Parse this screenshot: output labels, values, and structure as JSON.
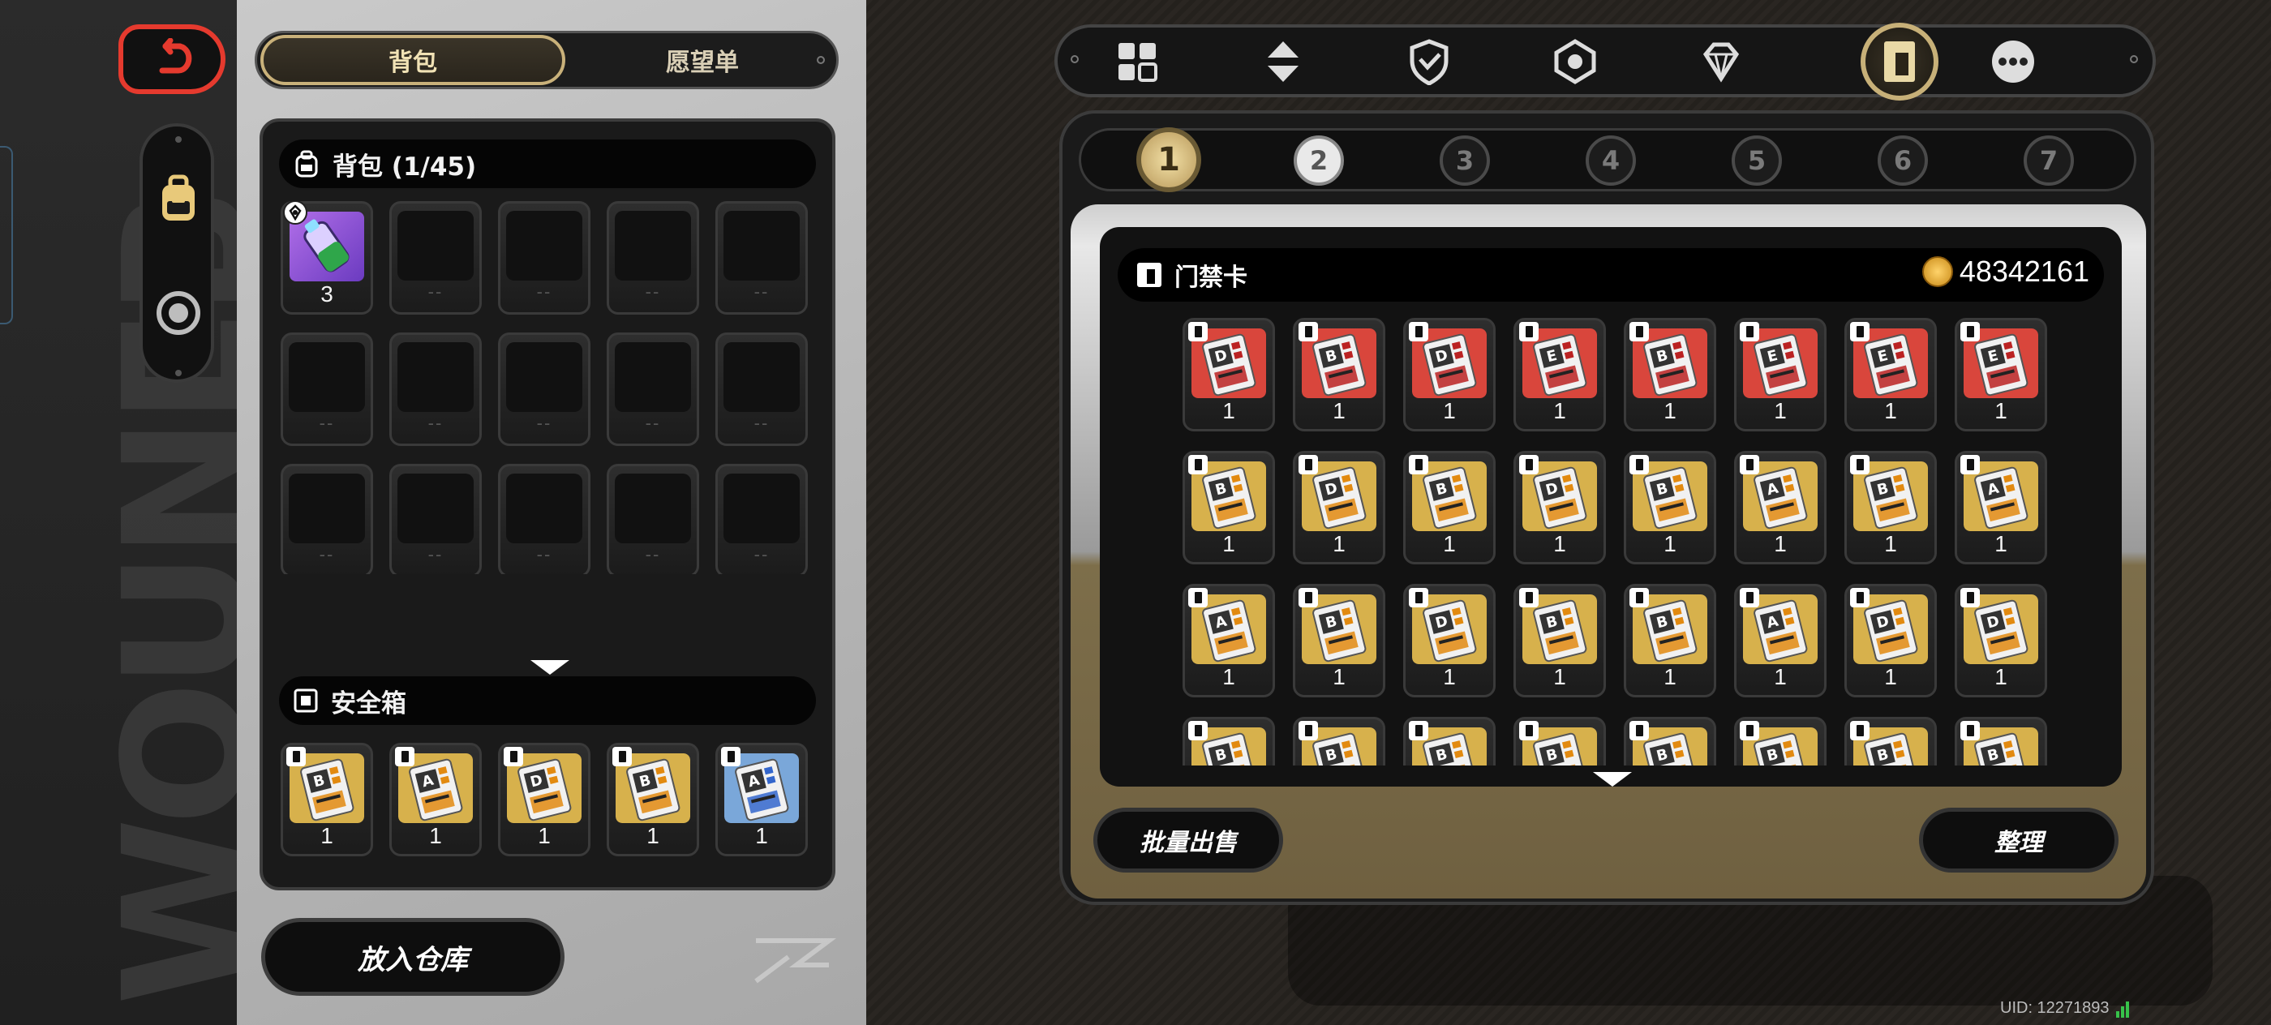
{
  "colors": {
    "gold_accent": "#c9b17a",
    "back_red": "#e53a2e",
    "card_red": "#d9463c",
    "card_gold": "#d7b14c",
    "signal_green": "#37c24a"
  },
  "left_strip": {
    "watermark": "WOUNEB"
  },
  "inventory": {
    "tabs": [
      "背包",
      "愿望单"
    ],
    "active_tab": "背包",
    "backpack": {
      "title": "背包 (1/45)",
      "slots": [
        {
          "item": "purple-consumable",
          "count": "3"
        },
        {
          "empty": "--"
        },
        {
          "empty": "--"
        },
        {
          "empty": "--"
        },
        {
          "empty": "--"
        },
        {
          "empty": "--"
        },
        {
          "empty": "--"
        },
        {
          "empty": "--"
        },
        {
          "empty": "--"
        },
        {
          "empty": "--"
        },
        {
          "empty": "--"
        },
        {
          "empty": "--"
        },
        {
          "empty": "--"
        },
        {
          "empty": "--"
        },
        {
          "empty": "--"
        },
        {
          "empty": "--"
        },
        {
          "empty": "--"
        },
        {
          "empty": "--"
        },
        {
          "empty": "--"
        },
        {
          "empty": "--"
        }
      ]
    },
    "safebox": {
      "title": "安全箱",
      "slots": [
        {
          "letter": "B",
          "tone": "gold",
          "count": "1"
        },
        {
          "letter": "A",
          "tone": "gold",
          "count": "1"
        },
        {
          "letter": "D",
          "tone": "gold",
          "count": "1"
        },
        {
          "letter": "B",
          "tone": "gold",
          "count": "1"
        },
        {
          "letter": "A",
          "tone": "blue",
          "count": "1"
        }
      ]
    },
    "store_button": "放入仓库"
  },
  "categories": {
    "icons": [
      "grid-icon",
      "arrows-icon",
      "shield-icon",
      "gear-icon",
      "diamond-icon",
      "keycard-icon",
      "more-icon"
    ],
    "active_index": 5
  },
  "detail": {
    "number_tabs": [
      "1",
      "2",
      "3",
      "4",
      "5",
      "6",
      "7"
    ],
    "active_number": "1",
    "header_title": "门禁卡",
    "gold_amount": "48342161",
    "cards": [
      {
        "letter": "D",
        "tone": "red",
        "count": "1"
      },
      {
        "letter": "B",
        "tone": "red",
        "count": "1"
      },
      {
        "letter": "D",
        "tone": "red",
        "count": "1"
      },
      {
        "letter": "E",
        "tone": "red",
        "count": "1"
      },
      {
        "letter": "B",
        "tone": "red",
        "count": "1"
      },
      {
        "letter": "E",
        "tone": "red",
        "count": "1"
      },
      {
        "letter": "E",
        "tone": "red",
        "count": "1"
      },
      {
        "letter": "E",
        "tone": "red",
        "count": "1"
      },
      {
        "letter": "B",
        "tone": "gold",
        "count": "1"
      },
      {
        "letter": "D",
        "tone": "gold",
        "count": "1"
      },
      {
        "letter": "B",
        "tone": "gold",
        "count": "1"
      },
      {
        "letter": "D",
        "tone": "gold",
        "count": "1"
      },
      {
        "letter": "B",
        "tone": "gold",
        "count": "1"
      },
      {
        "letter": "A",
        "tone": "gold",
        "count": "1"
      },
      {
        "letter": "B",
        "tone": "gold",
        "count": "1"
      },
      {
        "letter": "A",
        "tone": "gold",
        "count": "1"
      },
      {
        "letter": "A",
        "tone": "gold",
        "count": "1"
      },
      {
        "letter": "B",
        "tone": "gold",
        "count": "1"
      },
      {
        "letter": "D",
        "tone": "gold",
        "count": "1"
      },
      {
        "letter": "B",
        "tone": "gold",
        "count": "1"
      },
      {
        "letter": "B",
        "tone": "gold",
        "count": "1"
      },
      {
        "letter": "A",
        "tone": "gold",
        "count": "1"
      },
      {
        "letter": "D",
        "tone": "gold",
        "count": "1"
      },
      {
        "letter": "D",
        "tone": "gold",
        "count": "1"
      },
      {
        "letter": "B",
        "tone": "gold",
        "count": ""
      },
      {
        "letter": "B",
        "tone": "gold",
        "count": ""
      },
      {
        "letter": "B",
        "tone": "gold",
        "count": ""
      },
      {
        "letter": "B",
        "tone": "gold",
        "count": ""
      },
      {
        "letter": "B",
        "tone": "gold",
        "count": ""
      },
      {
        "letter": "B",
        "tone": "gold",
        "count": ""
      },
      {
        "letter": "B",
        "tone": "gold",
        "count": ""
      },
      {
        "letter": "B",
        "tone": "gold",
        "count": ""
      }
    ],
    "bulk_sell_button": "批量出售",
    "sort_button": "整理"
  },
  "uid": "UID: 12271893"
}
